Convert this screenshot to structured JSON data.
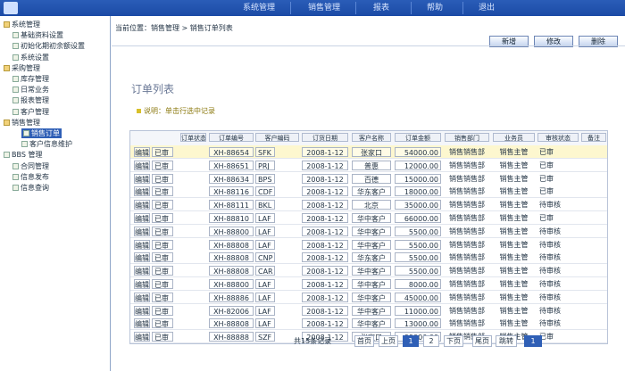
{
  "top_nav": [
    "系统管理",
    "销售管理",
    "报表",
    "帮助",
    "退出"
  ],
  "sidebar": {
    "items": [
      {
        "label": "系统管理",
        "indent": 0,
        "folder": true
      },
      {
        "label": "基础资料设置",
        "indent": 1
      },
      {
        "label": "初始化期初余额设置",
        "indent": 1
      },
      {
        "label": "系统设置",
        "indent": 1
      },
      {
        "label": "采购管理",
        "indent": 0,
        "folder": true
      },
      {
        "label": "库存管理",
        "indent": 1
      },
      {
        "label": "日常业务",
        "indent": 1
      },
      {
        "label": "报表管理",
        "indent": 1
      },
      {
        "label": "客户管理",
        "indent": 1
      },
      {
        "label": "销售管理",
        "indent": 0,
        "folder": true
      },
      {
        "label": "销售订单",
        "indent": 2,
        "active": true
      },
      {
        "label": "客户信息维护",
        "indent": 2
      },
      {
        "label": "BBS 管理",
        "indent": 0
      },
      {
        "label": "合同管理",
        "indent": 1
      },
      {
        "label": "信息发布",
        "indent": 1
      },
      {
        "label": "信息查询",
        "indent": 1
      }
    ]
  },
  "breadcrumb": "当前位置：销售管理 > 销售订单列表",
  "toolbar": {
    "buttons": [
      "新增",
      "修改",
      "删除"
    ]
  },
  "page_title": "订单列表",
  "page_note": "说明：单击行选中记录",
  "table": {
    "columns": [
      "订单状态",
      "订单编号",
      "客户编码",
      "订货日期",
      "客户名称",
      "订单金额",
      "销售部门",
      "业务员",
      "审核状态",
      "备注"
    ],
    "rows": [
      {
        "s1": "编辑",
        "s2": "已审",
        "id": "XH-88654",
        "cust": "SFK",
        "date": "2008-1-12",
        "name": "张家口",
        "amt": "54000.00",
        "dept": "销售销售部",
        "clerk": "销售主管",
        "audit": "已审",
        "sel": true
      },
      {
        "s1": "编辑",
        "s2": "已审",
        "id": "XH-88651",
        "cust": "PRJ",
        "date": "2008-1-12",
        "name": "普惠",
        "amt": "12000.00",
        "dept": "销售销售部",
        "clerk": "销售主管",
        "audit": "已审"
      },
      {
        "s1": "编辑",
        "s2": "已审",
        "id": "XH-88634",
        "cust": "BPS",
        "date": "2008-1-12",
        "name": "百德",
        "amt": "15000.00",
        "dept": "销售销售部",
        "clerk": "销售主管",
        "audit": "已审"
      },
      {
        "s1": "编辑",
        "s2": "已审",
        "id": "XH-88116",
        "cust": "CDF",
        "date": "2008-1-12",
        "name": "华东客户",
        "amt": "18000.00",
        "dept": "销售销售部",
        "clerk": "销售主管",
        "audit": "已审"
      },
      {
        "s1": "编辑",
        "s2": "已审",
        "id": "XH-88111",
        "cust": "BKL",
        "date": "2008-1-12",
        "name": "北京",
        "amt": "35000.00",
        "dept": "销售销售部",
        "clerk": "销售主管",
        "audit": "待审核"
      },
      {
        "s1": "编辑",
        "s2": "已审",
        "id": "XH-88810",
        "cust": "LAF",
        "date": "2008-1-12",
        "name": "华中客户",
        "amt": "66000.00",
        "dept": "销售销售部",
        "clerk": "销售主管",
        "audit": "已审"
      },
      {
        "s1": "编辑",
        "s2": "已审",
        "id": "XH-88800",
        "cust": "LAF",
        "date": "2008-1-12",
        "name": "华中客户",
        "amt": "5500.00",
        "dept": "销售销售部",
        "clerk": "销售主管",
        "audit": "待审核"
      },
      {
        "s1": "编辑",
        "s2": "已审",
        "id": "XH-88808",
        "cust": "LAF",
        "date": "2008-1-12",
        "name": "华中客户",
        "amt": "5500.00",
        "dept": "销售销售部",
        "clerk": "销售主管",
        "audit": "待审核"
      },
      {
        "s1": "编辑",
        "s2": "已审",
        "id": "XH-88808",
        "cust": "CNP",
        "date": "2008-1-12",
        "name": "华东客户",
        "amt": "5500.00",
        "dept": "销售销售部",
        "clerk": "销售主管",
        "audit": "待审核"
      },
      {
        "s1": "编辑",
        "s2": "已审",
        "id": "XH-88808",
        "cust": "CAR",
        "date": "2008-1-12",
        "name": "华中客户",
        "amt": "5500.00",
        "dept": "销售销售部",
        "clerk": "销售主管",
        "audit": "待审核"
      },
      {
        "s1": "编辑",
        "s2": "已审",
        "id": "XH-88800",
        "cust": "LAF",
        "date": "2008-1-12",
        "name": "华中客户",
        "amt": "8000.00",
        "dept": "销售销售部",
        "clerk": "销售主管",
        "audit": "待审核"
      },
      {
        "s1": "编辑",
        "s2": "已审",
        "id": "XH-88886",
        "cust": "LAF",
        "date": "2008-1-12",
        "name": "华中客户",
        "amt": "45000.00",
        "dept": "销售销售部",
        "clerk": "销售主管",
        "audit": "待审核"
      },
      {
        "s1": "编辑",
        "s2": "已审",
        "id": "XH-82006",
        "cust": "LAF",
        "date": "2008-1-12",
        "name": "华中客户",
        "amt": "11000.00",
        "dept": "销售销售部",
        "clerk": "销售主管",
        "audit": "待审核"
      },
      {
        "s1": "编辑",
        "s2": "已审",
        "id": "XH-88808",
        "cust": "LAF",
        "date": "2008-1-12",
        "name": "华中客户",
        "amt": "13000.00",
        "dept": "销售销售部",
        "clerk": "销售主管",
        "audit": "待审核"
      },
      {
        "s1": "编辑",
        "s2": "已审",
        "id": "XH-88888",
        "cust": "SZF",
        "date": "2008-1-12",
        "name": "张家口",
        "amt": "99000.00",
        "dept": "销售销售部",
        "clerk": "销售主管",
        "audit": "已审"
      }
    ]
  },
  "pager": {
    "info": "共15条记录",
    "buttons": [
      "首页",
      "上页",
      "1",
      "2",
      "下页",
      "尾页",
      "跳转"
    ],
    "current": "1",
    "page_input": "1"
  },
  "colors": {
    "top_bar": "#1b4aa6",
    "active_item": "#2f5fb6",
    "selected_row": "#fdf7cf",
    "note": "#8c7a10"
  }
}
